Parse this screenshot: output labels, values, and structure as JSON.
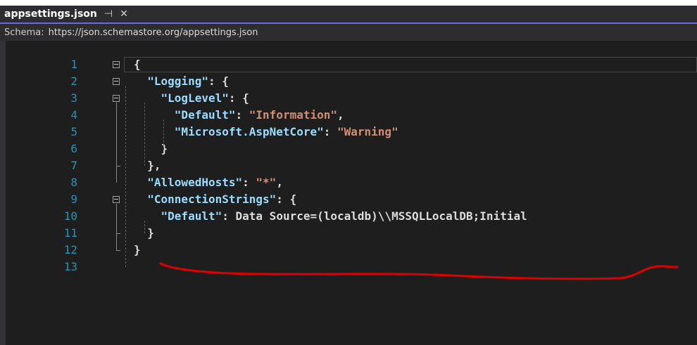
{
  "tab": {
    "filename": "appsettings.json",
    "pin_icon": "pin-icon",
    "close_icon": "close-icon"
  },
  "schema": {
    "label": "Schema:",
    "url": "https://json.schemastore.org/appsettings.json"
  },
  "lines": [
    {
      "n": "1",
      "text": "{"
    },
    {
      "n": "2",
      "text": "  \"Logging\": {"
    },
    {
      "n": "3",
      "text": "    \"LogLevel\": {"
    },
    {
      "n": "4",
      "text": "      \"Default\": \"Information\","
    },
    {
      "n": "5",
      "text": "      \"Microsoft.AspNetCore\": \"Warning\""
    },
    {
      "n": "6",
      "text": "    }"
    },
    {
      "n": "7",
      "text": "  },"
    },
    {
      "n": "8",
      "text": "  \"AllowedHosts\": \"*\","
    },
    {
      "n": "9",
      "text": "  \"ConnectionStrings\": {"
    },
    {
      "n": "10",
      "text": "    \"Default\": \"Data Source=(localdb)\\\\MSSQLLocalDB;Initial"
    },
    {
      "n": "11",
      "text": "  }"
    },
    {
      "n": "12",
      "text": "}"
    },
    {
      "n": "13",
      "text": ""
    }
  ],
  "colors": {
    "line_number": "#2b91af",
    "property": "#9cdcfe",
    "string": "#ce9178",
    "annotation": "#e00000"
  }
}
